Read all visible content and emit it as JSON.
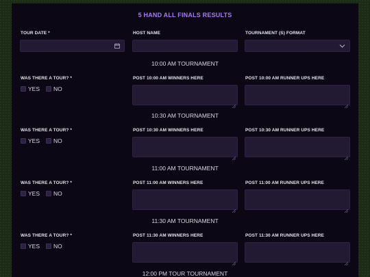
{
  "form": {
    "title": "5 HAND ALL FINALS RESULTS",
    "tour_date_label": "TOUR DATE *",
    "tour_date_value": "",
    "host_name_label": "HOST NAME",
    "host_name_value": "",
    "format_label": "TOURNAMENT (S) FORMAT",
    "format_value": ""
  },
  "sections": [
    {
      "heading": "10:00 AM TOURNAMENT",
      "tour_label": "WAS THERE A TOUR? *",
      "yes_label": "YES",
      "no_label": "NO",
      "winners_label": "POST 10:00 AM WINNERS HERE",
      "runner_ups_label": "POST 10:00 AM RUNNER UPS HERE"
    },
    {
      "heading": "10:30 AM TOURNAMENT",
      "tour_label": "WAS THERE A TOUR? *",
      "yes_label": "YES",
      "no_label": "NO",
      "winners_label": "POST 10:30 AM WINNERS HERE",
      "runner_ups_label": "POST 10:30 AM RUNNER UPS HERE"
    },
    {
      "heading": "11:00 AM TOURNAMENT",
      "tour_label": "WAS THERE A TOUR? *",
      "yes_label": "YES",
      "no_label": "NO",
      "winners_label": "POST 11:00 AM WINNERS HERE",
      "runner_ups_label": "POST 11:00 AM RUNNER UPS HERE"
    },
    {
      "heading": "11:30 AM TOURNAMENT",
      "tour_label": "WAS THERE A TOUR? *",
      "yes_label": "YES",
      "no_label": "NO",
      "winners_label": "POST 11:30 AM WINNERS HERE",
      "runner_ups_label": "POST 11:30 AM RUNNER UPS HERE"
    }
  ],
  "next_heading": "12:00 PM TOUR TOURNAMENT",
  "icons": {
    "date": "calendar-icon",
    "select": "chevron-down-icon",
    "resize": "resize-grip-icon"
  },
  "colors": {
    "accent": "#a67cf0",
    "panel": "#0b0714",
    "field": "#221a33"
  }
}
